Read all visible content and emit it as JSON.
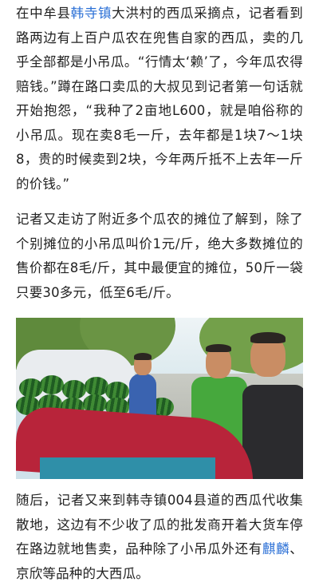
{
  "article": {
    "para1": [
      {
        "text": "在中牟县",
        "link": false
      },
      {
        "text": "韩寺镇",
        "link": true
      },
      {
        "text": "大洪村的西瓜采摘点，记者看到路两边有上百户瓜农在兜售自家的西瓜，卖的几乎全部都是小吊瓜。“行情太‘赖’了，今年瓜农得赔钱。”蹲在路口卖瓜的大叔见到记者第一句话就开始抱怨，“我种了2亩地L600，就是咱俗称的小吊瓜。现在卖8毛一斤，去年都是1块7～1块8，贵的时候卖到2块，今年两斤抵不上去年一斤的价钱。”",
        "link": false
      }
    ],
    "para2": [
      {
        "text": "记者又走访了附近多个瓜农的摊位了解到，除了个别摊位的小吊瓜叫价1元/斤，绝大多数摊位的售价都在8毛/斤，其中最便宜的摊位，50斤一袋只要30多元，低至6毛/斤。",
        "link": false
      }
    ],
    "para3": [
      {
        "text": "随后，记者又来到韩寺镇004县道的西瓜代收集散地，这边有不少收了瓜的批发商开着大货车停在路边就地售卖，品种除了小吊瓜外还有",
        "link": false
      },
      {
        "text": "麒麟",
        "link": true
      },
      {
        "text": "、京欣等品种的大西瓜。",
        "link": false
      }
    ]
  },
  "colors": {
    "text": "#222222",
    "link": "#2a6fd6",
    "background": "#ffffff"
  },
  "photo": {
    "icon": "watermelon-stall-photo"
  }
}
